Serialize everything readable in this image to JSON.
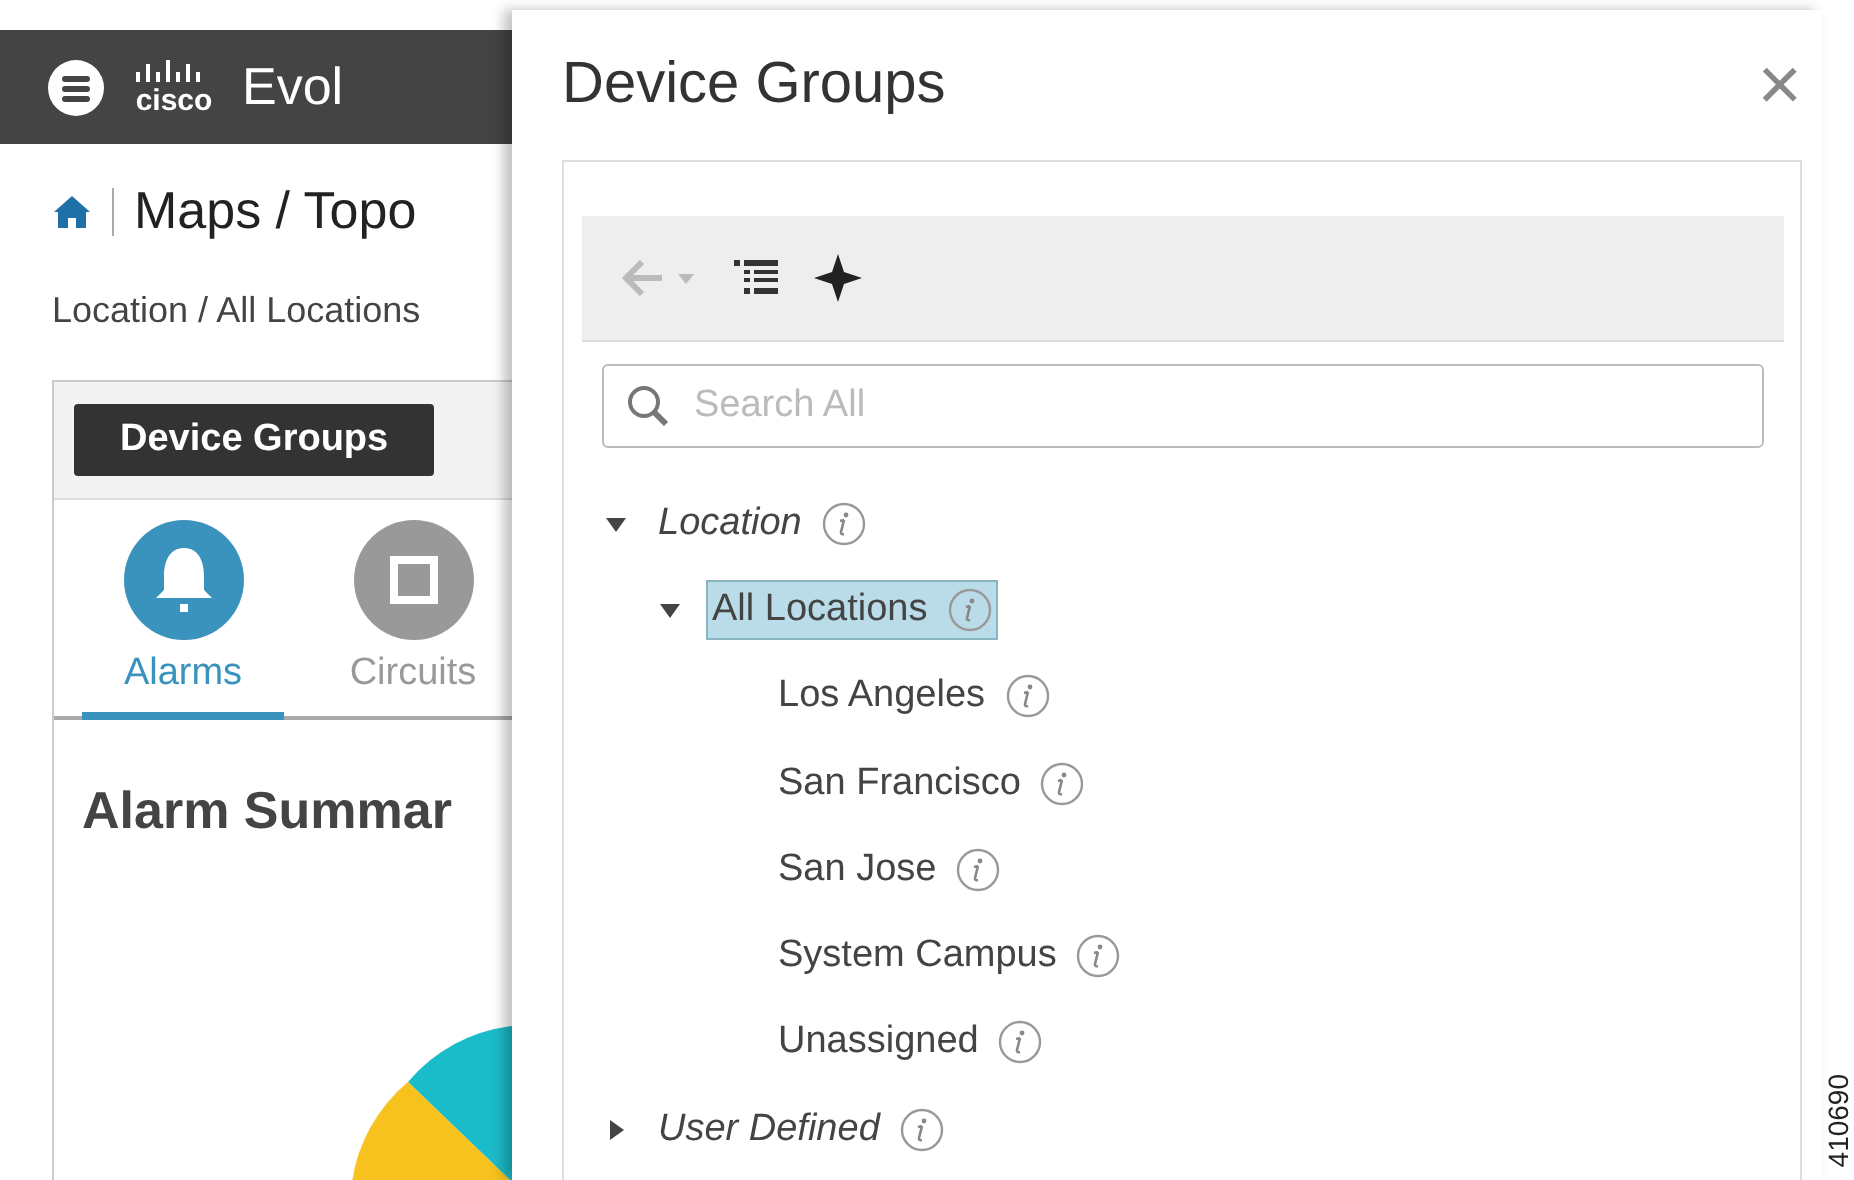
{
  "header": {
    "logo": "cisco",
    "app_title": "Evol"
  },
  "breadcrumb": {
    "title": "Maps / Topo",
    "path": "Location / All Locations"
  },
  "callout": {
    "label": "Device Groups"
  },
  "dashboard_tabs": [
    {
      "label": "Alarms",
      "selected": true
    },
    {
      "label": "Circuits",
      "selected": false
    }
  ],
  "summary": {
    "title": "Alarm Summar"
  },
  "panel": {
    "title": "Device Groups",
    "close": "×",
    "search": {
      "placeholder": "Search All"
    },
    "tree": [
      {
        "label": "Location",
        "expanded": true,
        "selected": false,
        "children": [
          {
            "label": "All Locations",
            "expanded": true,
            "selected": true,
            "children": [
              {
                "label": "Los Angeles",
                "selected": false
              },
              {
                "label": "San Francisco",
                "selected": false
              },
              {
                "label": "San Jose",
                "selected": false
              },
              {
                "label": "System Campus",
                "selected": false
              },
              {
                "label": "Unassigned",
                "selected": false
              }
            ]
          }
        ]
      },
      {
        "label": "User Defined",
        "expanded": false,
        "selected": false
      }
    ]
  },
  "figure_number": "410690"
}
